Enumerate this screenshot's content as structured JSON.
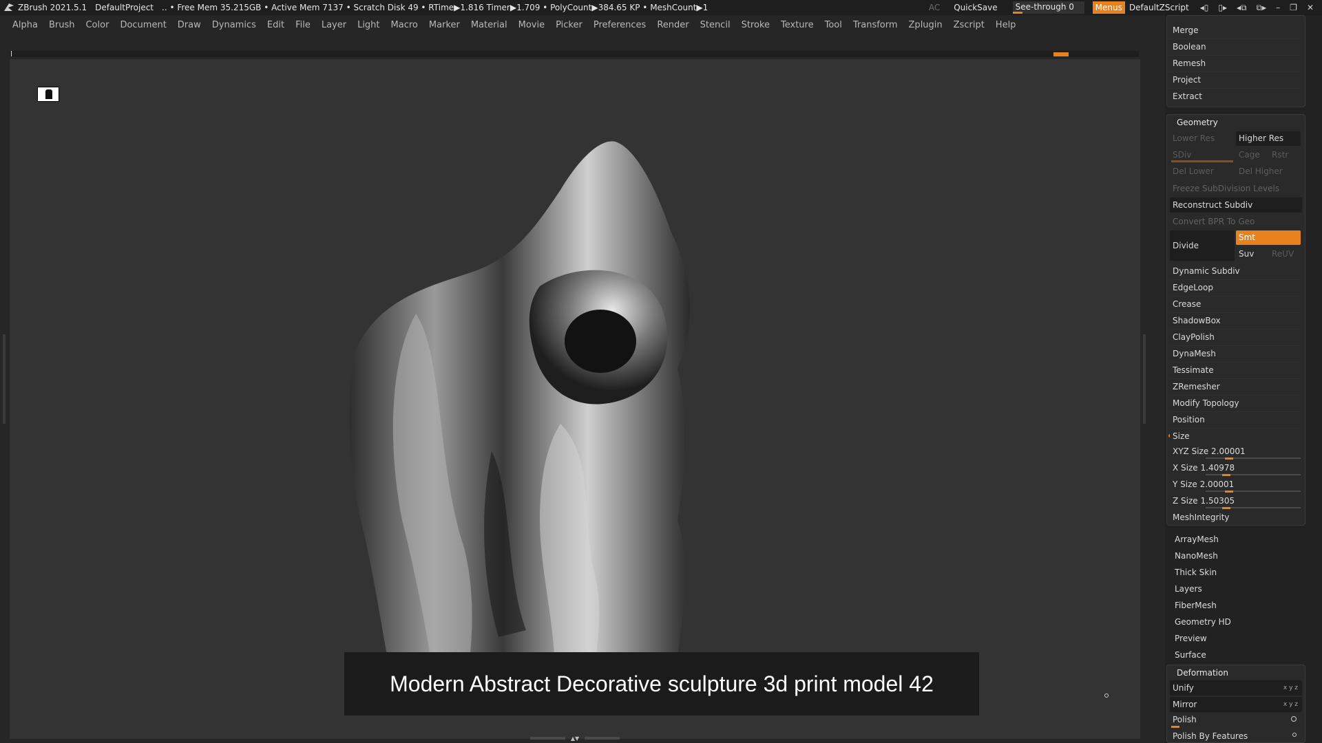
{
  "titlebar": {
    "app": "ZBrush 2021.5.1",
    "project": "DefaultProject",
    "stats": ".. • Free Mem 35.215GB • Active Mem 7137 • Scratch Disk 49 •  RTime▶1.816 Timer▶1.709 • PolyCount▶384.65 KP  • MeshCount▶1",
    "ac": "AC",
    "quicksave": "QuickSave",
    "seethrough": "See-through  0",
    "menus": "Menus",
    "script": "DefaultZScript"
  },
  "menubar": [
    "Alpha",
    "Brush",
    "Color",
    "Document",
    "Draw",
    "Dynamics",
    "Edit",
    "File",
    "Layer",
    "Light",
    "Macro",
    "Marker",
    "Material",
    "Movie",
    "Picker",
    "Preferences",
    "Render",
    "Stencil",
    "Stroke",
    "Texture",
    "Tool",
    "Transform",
    "Zplugin",
    "Zscript",
    "Help"
  ],
  "viewport": {
    "caption": "Modern Abstract Decorative sculpture 3d print model 42"
  },
  "panel": {
    "top_items": [
      "Merge",
      "Boolean",
      "Remesh",
      "Project",
      "Extract"
    ],
    "geometry": {
      "title": "Geometry",
      "lower_res": "Lower Res",
      "higher_res": "Higher Res",
      "sdiv": "SDiv",
      "cage": "Cage",
      "rstr": "Rstr",
      "del_lower": "Del Lower",
      "del_higher": "Del Higher",
      "freeze": "Freeze SubDivision Levels",
      "reconstruct": "Reconstruct Subdiv",
      "convert_bpr": "Convert BPR To Geo",
      "divide": "Divide",
      "smt": "Smt",
      "suv": "Suv",
      "reuv": "ReUV",
      "items": [
        "Dynamic Subdiv",
        "EdgeLoop",
        "Crease",
        "ShadowBox",
        "ClayPolish",
        "DynaMesh",
        "Tessimate",
        "ZRemesher",
        "Modify Topology",
        "Position"
      ],
      "size_title": "Size",
      "sizes": [
        {
          "label": "XYZ Size",
          "value": "2.00001"
        },
        {
          "label": "X Size",
          "value": "1.40978"
        },
        {
          "label": "Y Size",
          "value": "2.00001"
        },
        {
          "label": "Z Size",
          "value": "1.50305"
        }
      ],
      "mesh_integrity": "MeshIntegrity"
    },
    "sections": [
      "ArrayMesh",
      "NanoMesh",
      "Thick Skin",
      "Layers",
      "FiberMesh",
      "Geometry HD",
      "Preview",
      "Surface"
    ],
    "deformation": {
      "title": "Deformation",
      "items": [
        "Unify",
        "Mirror",
        "Polish",
        "Polish By Features"
      ]
    }
  }
}
